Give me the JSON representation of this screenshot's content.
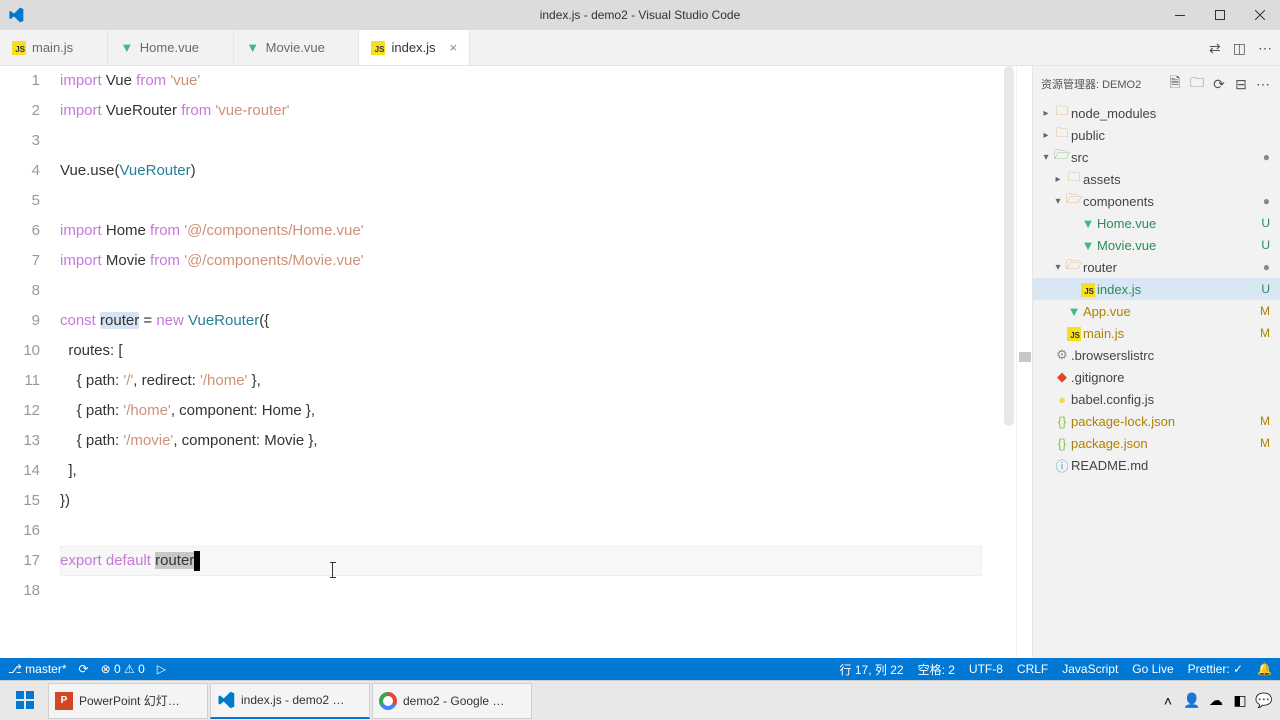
{
  "window": {
    "title": "index.js - demo2 - Visual Studio Code"
  },
  "tabs": [
    {
      "label": "main.js",
      "icon": "js",
      "active": false
    },
    {
      "label": "Home.vue",
      "icon": "vue",
      "active": false
    },
    {
      "label": "Movie.vue",
      "icon": "vue",
      "active": false
    },
    {
      "label": "index.js",
      "icon": "js",
      "active": true
    }
  ],
  "code": {
    "lines": [
      [
        {
          "t": "kw",
          "s": "import"
        },
        {
          "t": "plain",
          "s": " Vue "
        },
        {
          "t": "kw",
          "s": "from"
        },
        {
          "t": "plain",
          "s": " "
        },
        {
          "t": "str",
          "s": "'vue'"
        }
      ],
      [
        {
          "t": "kw",
          "s": "import"
        },
        {
          "t": "plain",
          "s": " VueRouter "
        },
        {
          "t": "kw",
          "s": "from"
        },
        {
          "t": "plain",
          "s": " "
        },
        {
          "t": "str",
          "s": "'vue-router'"
        }
      ],
      [],
      [
        {
          "t": "plain",
          "s": "Vue.use("
        },
        {
          "t": "var",
          "s": "VueRouter"
        },
        {
          "t": "plain",
          "s": ")"
        }
      ],
      [],
      [
        {
          "t": "kw",
          "s": "import"
        },
        {
          "t": "plain",
          "s": " Home "
        },
        {
          "t": "kw",
          "s": "from"
        },
        {
          "t": "plain",
          "s": " "
        },
        {
          "t": "str",
          "s": "'@/components/Home.vue'"
        }
      ],
      [
        {
          "t": "kw",
          "s": "import"
        },
        {
          "t": "plain",
          "s": " Movie "
        },
        {
          "t": "kw",
          "s": "from"
        },
        {
          "t": "plain",
          "s": " "
        },
        {
          "t": "str",
          "s": "'@/components/Movie.vue'"
        }
      ],
      [],
      [
        {
          "t": "kw",
          "s": "const"
        },
        {
          "t": "plain",
          "s": " "
        },
        {
          "t": "hl",
          "s": "router"
        },
        {
          "t": "plain",
          "s": " = "
        },
        {
          "t": "kw",
          "s": "new"
        },
        {
          "t": "plain",
          "s": " "
        },
        {
          "t": "var",
          "s": "VueRouter"
        },
        {
          "t": "plain",
          "s": "({"
        }
      ],
      [
        {
          "t": "plain",
          "s": "  routes: ["
        }
      ],
      [
        {
          "t": "plain",
          "s": "    { path: "
        },
        {
          "t": "str",
          "s": "'/'"
        },
        {
          "t": "plain",
          "s": ", redirect: "
        },
        {
          "t": "str",
          "s": "'/home'"
        },
        {
          "t": "plain",
          "s": " },"
        }
      ],
      [
        {
          "t": "plain",
          "s": "    { path: "
        },
        {
          "t": "str",
          "s": "'/home'"
        },
        {
          "t": "plain",
          "s": ", component: Home },"
        }
      ],
      [
        {
          "t": "plain",
          "s": "    { path: "
        },
        {
          "t": "str",
          "s": "'/movie'"
        },
        {
          "t": "plain",
          "s": ", component: Movie },"
        }
      ],
      [
        {
          "t": "plain",
          "s": "  ],"
        }
      ],
      [
        {
          "t": "plain",
          "s": "})"
        }
      ],
      [],
      [
        {
          "t": "kw",
          "s": "export"
        },
        {
          "t": "plain",
          "s": " "
        },
        {
          "t": "default",
          "s": "default"
        },
        {
          "t": "plain",
          "s": " "
        },
        {
          "t": "sel",
          "s": "router"
        }
      ],
      []
    ],
    "current_line": 17
  },
  "sidebar": {
    "header": "资源管理器: DEMO2",
    "tree": [
      {
        "indent": 0,
        "chev": "▸",
        "icon": "folder",
        "name": "node_modules",
        "status": ""
      },
      {
        "indent": 0,
        "chev": "▸",
        "icon": "folder",
        "name": "public",
        "status": ""
      },
      {
        "indent": 0,
        "chev": "▾",
        "icon": "src",
        "name": "src",
        "status": "dot"
      },
      {
        "indent": 1,
        "chev": "▸",
        "icon": "folder",
        "name": "assets",
        "status": ""
      },
      {
        "indent": 1,
        "chev": "▾",
        "icon": "folder-open",
        "name": "components",
        "status": "dot"
      },
      {
        "indent": 2,
        "chev": "",
        "icon": "vue",
        "name": "Home.vue",
        "status": "U"
      },
      {
        "indent": 2,
        "chev": "",
        "icon": "vue",
        "name": "Movie.vue",
        "status": "U"
      },
      {
        "indent": 1,
        "chev": "▾",
        "icon": "folder-open",
        "name": "router",
        "status": "dot"
      },
      {
        "indent": 2,
        "chev": "",
        "icon": "js",
        "name": "index.js",
        "status": "U",
        "selected": true
      },
      {
        "indent": 1,
        "chev": "",
        "icon": "vue",
        "name": "App.vue",
        "status": "M"
      },
      {
        "indent": 1,
        "chev": "",
        "icon": "js",
        "name": "main.js",
        "status": "M"
      },
      {
        "indent": 0,
        "chev": "",
        "icon": "cfg",
        "name": ".browserslistrc",
        "status": ""
      },
      {
        "indent": 0,
        "chev": "",
        "icon": "git",
        "name": ".gitignore",
        "status": ""
      },
      {
        "indent": 0,
        "chev": "",
        "icon": "babel",
        "name": "babel.config.js",
        "status": ""
      },
      {
        "indent": 0,
        "chev": "",
        "icon": "json",
        "name": "package-lock.json",
        "status": "M"
      },
      {
        "indent": 0,
        "chev": "",
        "icon": "json",
        "name": "package.json",
        "status": "M"
      },
      {
        "indent": 0,
        "chev": "",
        "icon": "md",
        "name": "README.md",
        "status": ""
      }
    ]
  },
  "statusbar": {
    "branch": "master*",
    "sync": "⟳",
    "errors": "⊗ 0 ⚠ 0",
    "cursor": "行 17, 列 22",
    "spaces": "空格: 2",
    "encoding": "UTF-8",
    "eol": "CRLF",
    "lang": "JavaScript",
    "live": "Go Live",
    "prettier": "Prettier: ✓",
    "bell": "🔔"
  },
  "taskbar": {
    "items": [
      {
        "icon": "win",
        "label": ""
      },
      {
        "icon": "ppt",
        "label": "PowerPoint 幻灯…"
      },
      {
        "icon": "vscode",
        "label": "index.js - demo2 …",
        "active": true
      },
      {
        "icon": "chrome",
        "label": "demo2 - Google …"
      }
    ]
  }
}
